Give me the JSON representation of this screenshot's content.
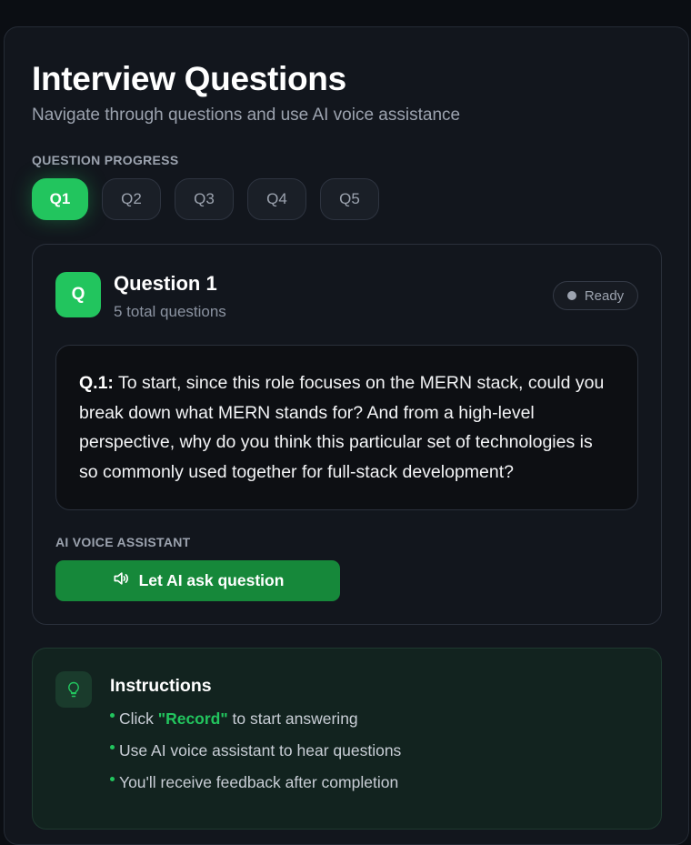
{
  "header": {
    "title": "Interview Questions",
    "subtitle": "Navigate through questions and use AI voice assistance"
  },
  "progress": {
    "label": "QUESTION PROGRESS",
    "tabs": [
      "Q1",
      "Q2",
      "Q3",
      "Q4",
      "Q5"
    ],
    "active_index": 0
  },
  "question_card": {
    "avatar_letter": "Q",
    "heading": "Question 1",
    "count_text": "5 total questions",
    "status": "Ready",
    "prefix": "Q.1:",
    "text": " To start, since this role focuses on the MERN stack, could you break down what MERN stands for? And from a high-level perspective, why do you think this particular set of technologies is so commonly used together for full-stack development?",
    "voice_label": "AI VOICE ASSISTANT",
    "voice_button": "Let AI ask question",
    "voice_icon": "speaker-icon"
  },
  "instructions": {
    "title": "Instructions",
    "icon": "lightbulb-icon",
    "items": [
      {
        "before": "Click ",
        "highlight": "\"Record\"",
        "after": " to start answering"
      },
      {
        "before": "Use AI voice assistant to hear questions",
        "highlight": "",
        "after": ""
      },
      {
        "before": "You'll receive feedback after completion",
        "highlight": "",
        "after": ""
      }
    ]
  },
  "colors": {
    "accent": "#22c55e",
    "button": "#16883a",
    "panel": "#12161d"
  }
}
